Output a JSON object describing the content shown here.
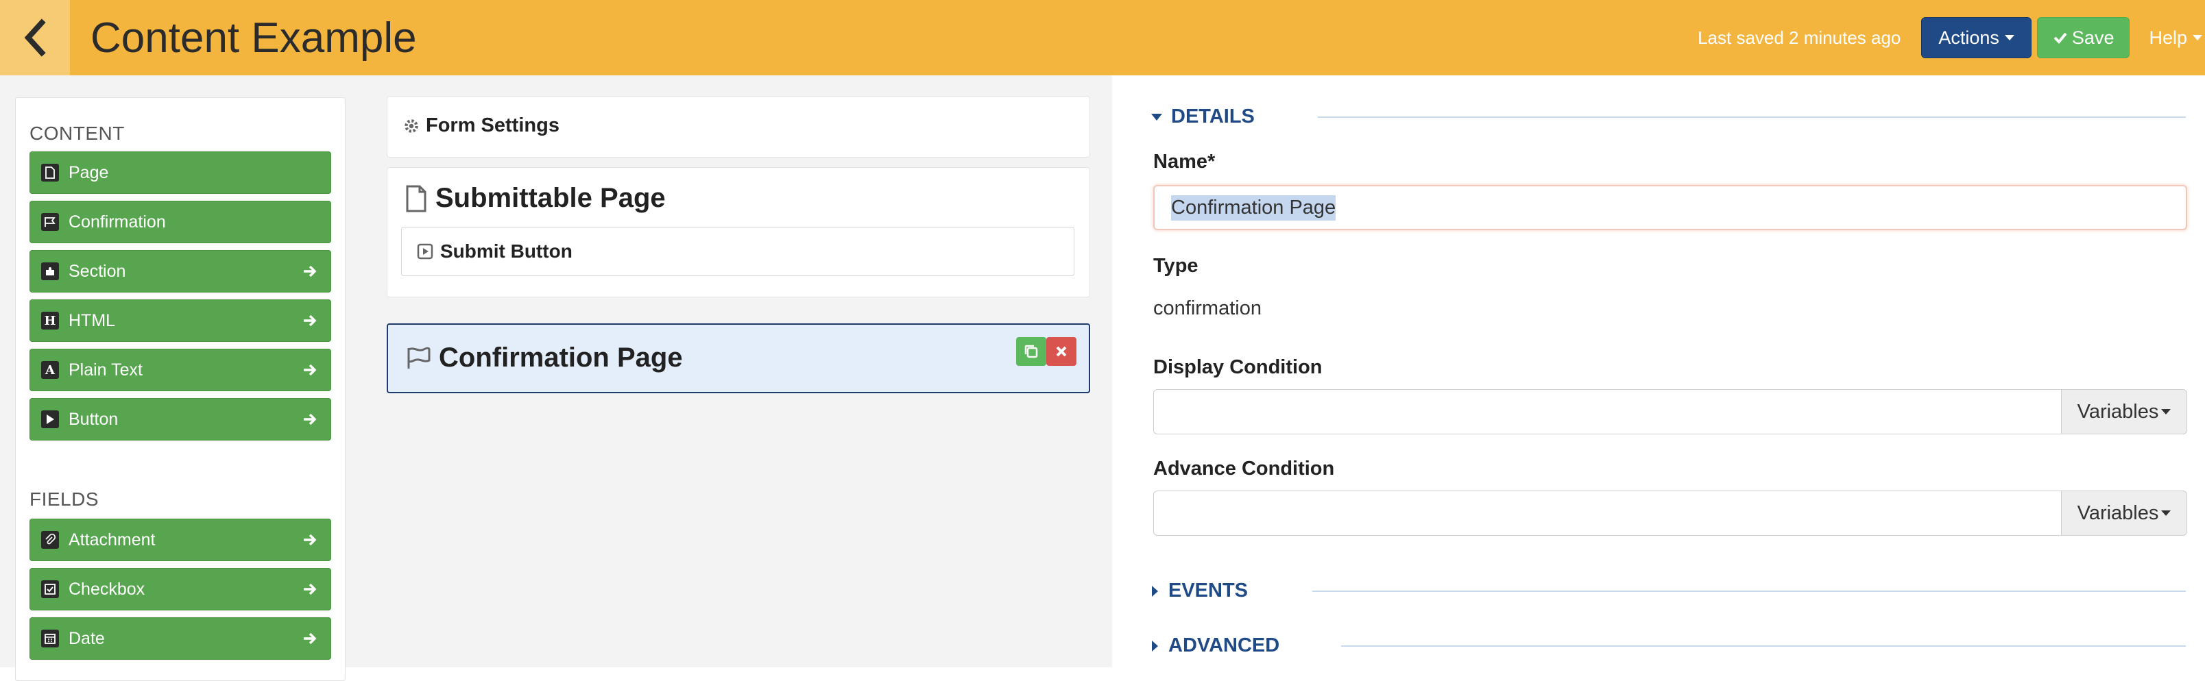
{
  "header": {
    "title": "Content Example",
    "last_saved": "Last saved 2 minutes ago",
    "actions_label": "Actions",
    "save_label": "Save",
    "help_label": "Help",
    "bg_color": "#f4b53f",
    "actions_color": "#1f4a86",
    "save_color": "#5cb85c"
  },
  "palette": {
    "content_title": "CONTENT",
    "content_items": [
      {
        "label": "Page",
        "icon": "file-icon"
      },
      {
        "label": "Confirmation",
        "icon": "flag-icon"
      },
      {
        "label": "Section",
        "icon": "puzzle-icon"
      },
      {
        "label": "HTML",
        "icon": "h-icon"
      },
      {
        "label": "Plain Text",
        "icon": "a-icon"
      },
      {
        "label": "Button",
        "icon": "play-icon"
      }
    ],
    "fields_title": "FIELDS",
    "field_items": [
      {
        "label": "Attachment",
        "icon": "paperclip-icon"
      },
      {
        "label": "Checkbox",
        "icon": "checkbox-icon"
      },
      {
        "label": "Date",
        "icon": "calendar-icon"
      }
    ],
    "item_color": "#57a54e"
  },
  "canvas": {
    "form_settings": "Form Settings",
    "submittable_page": "Submittable Page",
    "submit_button": "Submit Button",
    "confirmation_page": "Confirmation Page"
  },
  "details": {
    "details_heading": "DETAILS",
    "name_label": "Name*",
    "name_value": "Confirmation Page",
    "type_label": "Type",
    "type_value": "confirmation",
    "display_condition_label": "Display Condition",
    "advance_condition_label": "Advance Condition",
    "variables_label": "Variables",
    "events_heading": "EVENTS",
    "advanced_heading": "ADVANCED"
  }
}
